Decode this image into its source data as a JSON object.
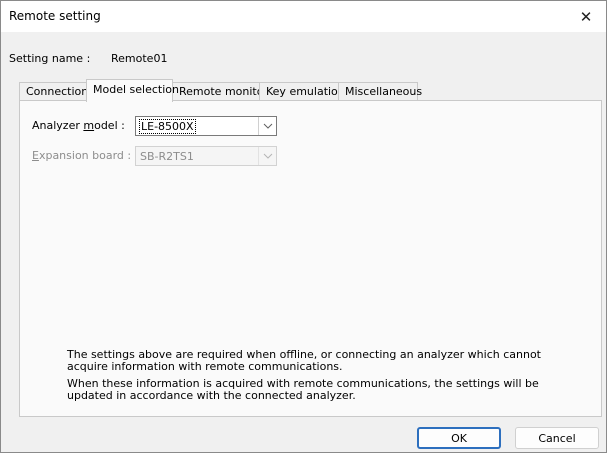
{
  "window": {
    "title": "Remote setting",
    "close_glyph": "✕"
  },
  "setting_name": {
    "label": "Setting name :",
    "value": "Remote01"
  },
  "tabs": [
    {
      "label": "Connection",
      "active": false
    },
    {
      "label": "Model selection",
      "active": true
    },
    {
      "label": "Remote monitor",
      "active": false
    },
    {
      "label": "Key emulation",
      "active": false
    },
    {
      "label": "Miscellaneous",
      "active": false
    }
  ],
  "model_selection": {
    "analyzer_model": {
      "label_pre": "Analyzer ",
      "label_accel": "m",
      "label_post": "odel :",
      "value": "LE-8500X"
    },
    "expansion_board": {
      "label_pre": "",
      "label_accel": "E",
      "label_post": "xpansion board :",
      "value": "SB-R2TS1"
    },
    "note_1": "The settings above are required when offline, or connecting an analyzer which cannot acquire information with remote communications.",
    "note_2": "When these information is acquired with remote communications, the settings will be updated in accordance with the connected analyzer."
  },
  "buttons": {
    "ok": "OK",
    "cancel": "Cancel"
  },
  "icons": {
    "dropdown": "chevron-down-icon",
    "close": "close-icon"
  },
  "colors": {
    "default_button_border": "#2d6fbe"
  }
}
